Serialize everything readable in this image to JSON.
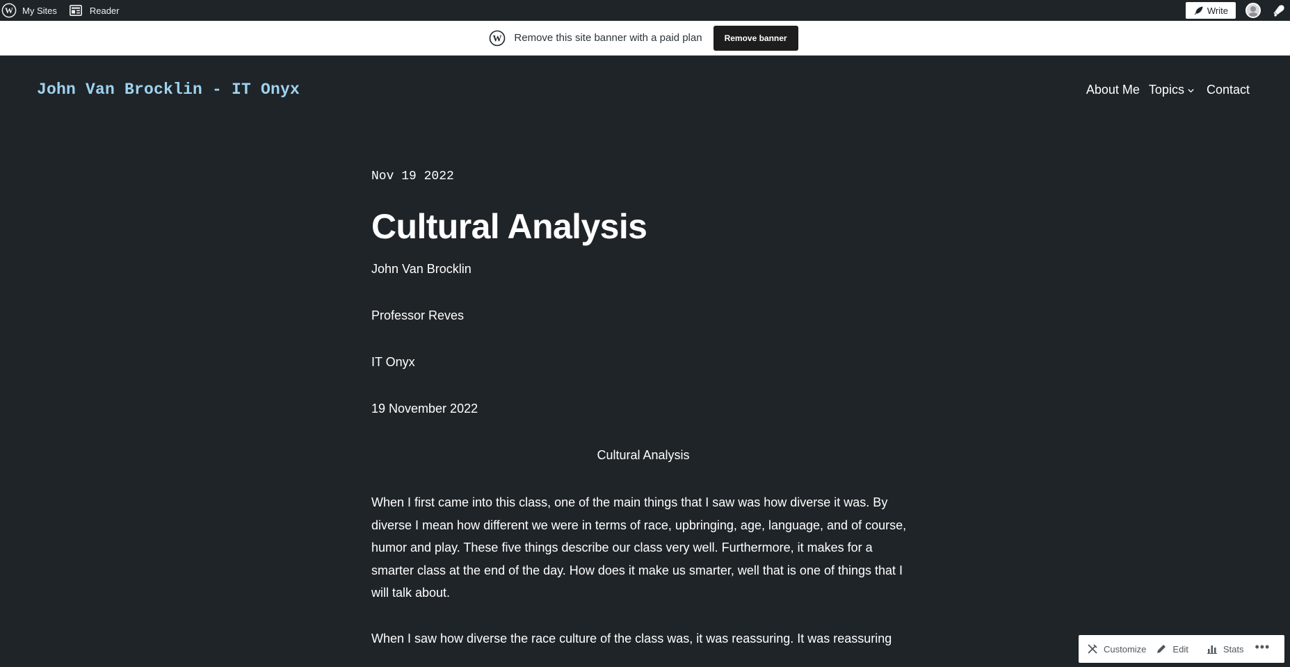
{
  "admin_bar": {
    "my_sites_label": "My Sites",
    "reader_label": "Reader",
    "write_label": "Write"
  },
  "banner": {
    "text": "Remove this site banner with a paid plan",
    "button_label": "Remove banner"
  },
  "site": {
    "title": "John Van Brocklin - IT Onyx",
    "title_color": "#9fd3f0",
    "nav": [
      {
        "label": "About Me"
      },
      {
        "label": "Topics"
      },
      {
        "label": "Contact"
      }
    ]
  },
  "post": {
    "date": "Nov 19 2022",
    "title": "Cultural Analysis",
    "meta": [
      "John Van Brocklin",
      "Professor Reves",
      "IT Onyx",
      "19 November 2022"
    ],
    "center_heading": "Cultural Analysis",
    "paragraphs": [
      "When I first came into this class, one of the main things that I saw was how diverse it was. By diverse I mean how different we were in terms of race, upbringing, age, language, and of course, humor and play. These five things describe our class very well. Furthermore, it makes for a smarter class at the end of the day. How does it make us smarter, well that is one of things that I will talk about.",
      "When I saw how diverse the race culture of the class was, it was reassuring. It was reassuring"
    ]
  },
  "action_bar": {
    "customize_label": "Customize",
    "edit_label": "Edit",
    "stats_label": "Stats",
    "more_label": "•••"
  },
  "colors": {
    "background": "#1f2428",
    "banner_button": "#1d1d1d"
  }
}
